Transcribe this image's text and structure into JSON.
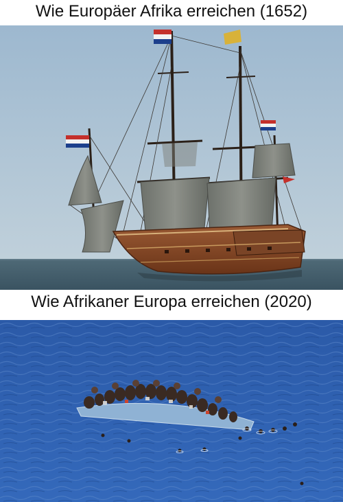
{
  "captions": {
    "top": "Wie Europäer Afrika erreichen (1652)",
    "bottom": "Wie Afrikaner Europa erreichen (2020)"
  },
  "images": {
    "top": "photo-sailing-ship",
    "bottom": "photo-overcrowded-boat"
  },
  "colors": {
    "sky": "#a8bfd2",
    "sea_top": "#3e5a6b",
    "sea_bottom": "#2f63b3",
    "hull": "#8a4a2a",
    "sail": "#7b7f78",
    "flag_red": "#c4302b",
    "flag_blue": "#1c3f8c"
  }
}
